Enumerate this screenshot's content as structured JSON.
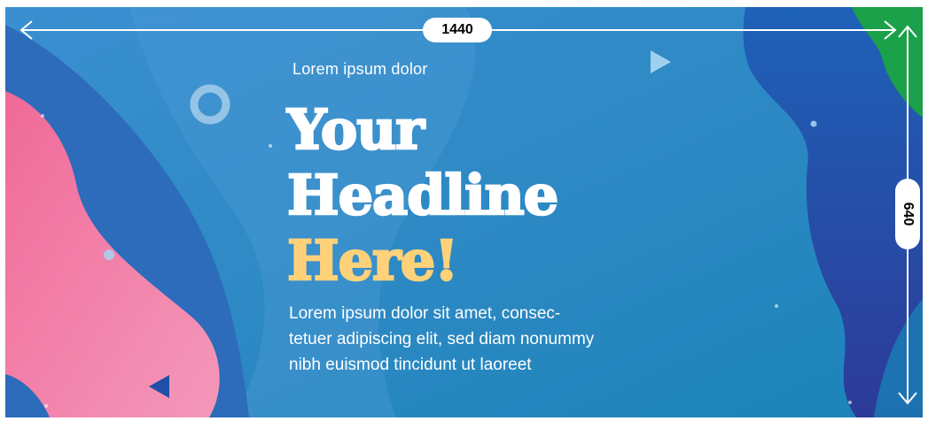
{
  "banner": {
    "subheading": "Lorem ipsum dolor",
    "headline_lines": [
      "Your",
      "Headline",
      "Here!"
    ],
    "body_lines": [
      "Lorem ipsum dolor sit amet, consec-",
      "tetuer adipiscing elit, sed diam nonummy",
      "nibh euismod tincidunt ut laoreet"
    ],
    "colors": {
      "background": "#2f86c4",
      "headline": "#ffffff",
      "headline_accent": "#ffd27a",
      "pink_wave": "#f07aa0",
      "green_corner": "#1aa14a",
      "dark_blue_wave": "#2a63b8"
    }
  },
  "dimensions": {
    "width_label": "1440",
    "height_label": "640"
  }
}
